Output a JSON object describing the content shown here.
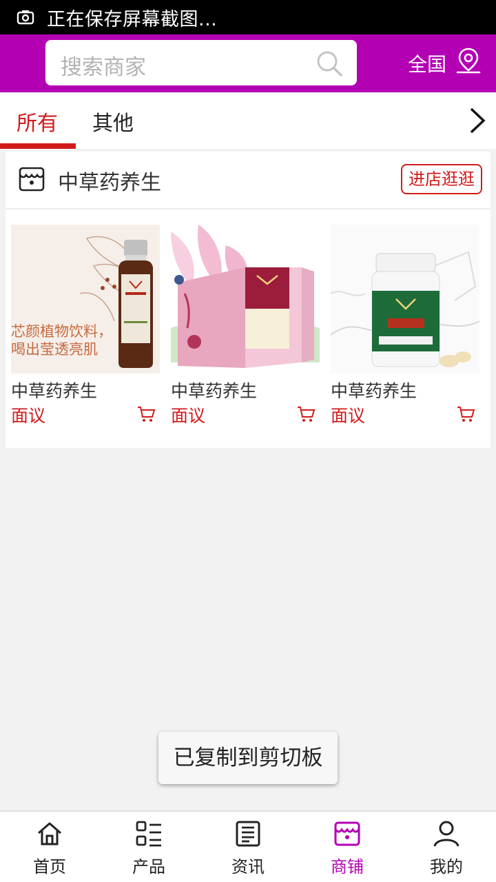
{
  "status_bar": {
    "text": "正在保存屏幕截图..."
  },
  "header": {
    "search_placeholder": "搜索商家",
    "region_label": "全国",
    "brand_color": "#b300b3"
  },
  "tabs": [
    {
      "label": "所有",
      "active": true
    },
    {
      "label": "其他",
      "active": false
    }
  ],
  "store": {
    "name": "中草药养生",
    "visit_label": "进店逛逛",
    "products": [
      {
        "name": "中草药养生",
        "price": "面议",
        "image_caption": [
          "芯颜植物饮料，",
          "喝出莹透亮肌"
        ]
      },
      {
        "name": "中草药养生",
        "price": "面议"
      },
      {
        "name": "中草药养生",
        "price": "面议"
      }
    ]
  },
  "toast": "已复制到剪切板",
  "bottom_nav": [
    {
      "label": "首页",
      "icon": "home-icon",
      "active": false
    },
    {
      "label": "产品",
      "icon": "list-icon",
      "active": false
    },
    {
      "label": "资讯",
      "icon": "news-icon",
      "active": false
    },
    {
      "label": "商铺",
      "icon": "shop-icon",
      "active": true
    },
    {
      "label": "我的",
      "icon": "user-icon",
      "active": false
    }
  ],
  "colors": {
    "accent": "#d11b1b",
    "active_nav": "#b300b3"
  }
}
